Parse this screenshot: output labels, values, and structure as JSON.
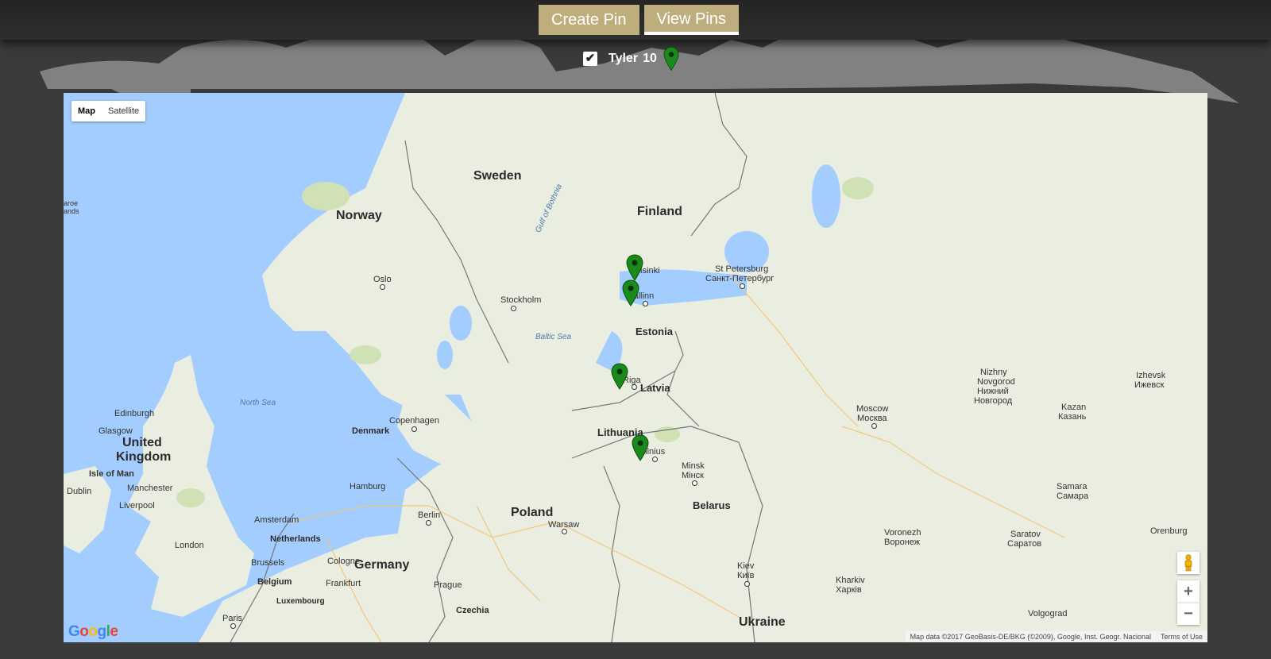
{
  "nav": {
    "create_pin_label": "Create Pin",
    "view_pins_label": "View Pins",
    "active_tab": "View Pins"
  },
  "legend": {
    "checked": true,
    "user_name": "Tyler",
    "pin_count": "10",
    "pin_color": "#1a8a1a"
  },
  "map": {
    "map_type": {
      "map_label": "Map",
      "satellite_label": "Satellite",
      "selected": "Map"
    },
    "zoom_in_label": "+",
    "zoom_out_label": "−",
    "attribution": "Map data ©2017 GeoBasis-DE/BKG (©2009), Google, Inst. Geogr. Nacional",
    "terms_label": "Terms of Use",
    "logo_text": "Google",
    "labels": {
      "sweden": "Sweden",
      "norway": "Norway",
      "finland": "Finland",
      "estonia": "Estonia",
      "latvia": "Latvia",
      "lithuania": "Lithuania",
      "belarus": "Belarus",
      "poland": "Poland",
      "germany": "Germany",
      "denmark": "Denmark",
      "uk_line1": "United",
      "uk_line2": "Kingdom",
      "ukraine": "Ukraine",
      "netherlands": "Netherlands",
      "belgium": "Belgium",
      "luxembourg": "Luxembourg",
      "czechia": "Czechia",
      "gulf_bothnia": "Gulf of Bothnia",
      "baltic_sea": "Baltic Sea",
      "north_sea": "North Sea",
      "faroe_line1": "aroe",
      "faroe_line2": "ands",
      "oslo": "Oslo",
      "stockholm": "Stockholm",
      "helsinki": "Helsinki",
      "tallinn": "Tallinn",
      "riga": "Riga",
      "vilnius": "Vilnius",
      "minsk1": "Minsk",
      "minsk2": "Мінск",
      "stpete1": "St Petersburg",
      "stpete2": "Санкт-Петербург",
      "moscow1": "Moscow",
      "moscow2": "Москва",
      "nizhny1": "Nizhny",
      "nizhny2": "Novgorod",
      "nizhny3": "Нижний",
      "nizhny4": "Новгород",
      "izhevsk1": "Izhevsk",
      "izhevsk2": "Ижевск",
      "kazan1": "Kazan",
      "kazan2": "Казань",
      "samara1": "Samara",
      "samara2": "Самара",
      "saratov1": "Saratov",
      "saratov2": "Саратов",
      "voronezh1": "Voronezh",
      "voronezh2": "Воронеж",
      "kharkiv1": "Kharkiv",
      "kharkiv2": "Харків",
      "kiev1": "Kiev",
      "kiev2": "Київ",
      "volgograd": "Volgograd",
      "orenburg": "Orenburg",
      "copenhagen": "Copenhagen",
      "hamburg": "Hamburg",
      "berlin": "Berlin",
      "warsaw": "Warsaw",
      "prague": "Prague",
      "amsterdam": "Amsterdam",
      "brussels": "Brussels",
      "cologne": "Cologne",
      "frankfurt": "Frankfurt",
      "london": "London",
      "paris": "Paris",
      "manchester": "Manchester",
      "liverpool": "Liverpool",
      "dublin": "Dublin",
      "isle_of_man": "Isle of Man",
      "edinburgh": "Edinburgh",
      "glasgow": "Glasgow"
    }
  }
}
